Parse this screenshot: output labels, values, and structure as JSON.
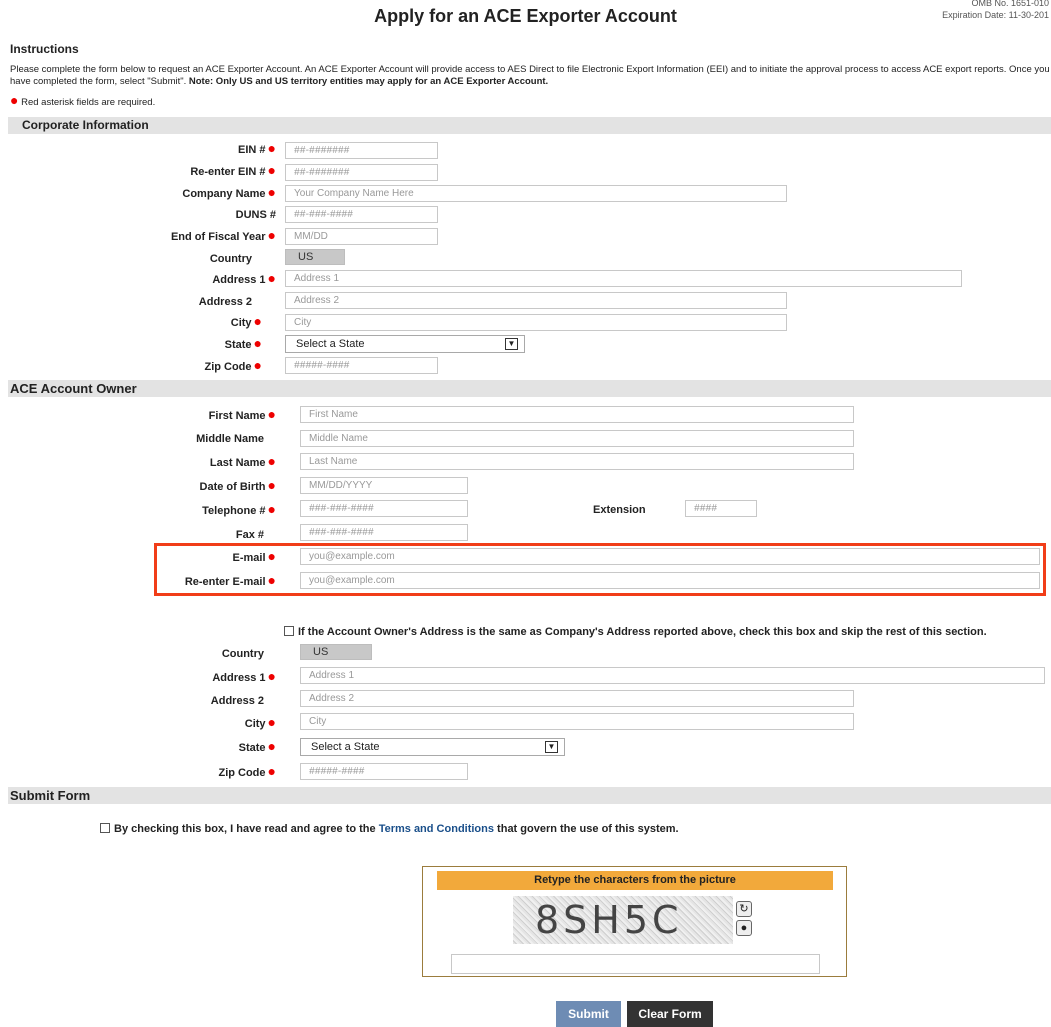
{
  "header": {
    "title": "Apply for an ACE Exporter Account",
    "omb_line": "OMB No. 1651-010",
    "expiration": "Expiration Date: 11-30-201"
  },
  "instructions": {
    "heading": "Instructions",
    "text_1": "Please complete the form below to request an ACE Exporter Account. An ACE Exporter Account will provide access to AES Direct to file Electronic Export Information (EEI) and to initiate the approval process to access ACE export reports. Once you have completed the form, select \"Submit\". ",
    "text_bold": "Note: Only US and US territory entities may apply for an ACE Exporter Account.",
    "required_note": "Red asterisk fields are required."
  },
  "corporate": {
    "section_title": "Corporate Information",
    "ein_label": "EIN #",
    "ein_placeholder": "##-#######",
    "reein_label": "Re-enter EIN #",
    "reein_placeholder": "##-#######",
    "company_label": "Company Name",
    "company_placeholder": "Your Company Name Here",
    "duns_label": "DUNS #",
    "duns_placeholder": "##-###-####",
    "fiscal_label": "End of Fiscal Year",
    "fiscal_placeholder": "MM/DD",
    "country_label": "Country",
    "country_value": "US",
    "address1_label": "Address 1",
    "address1_placeholder": "Address 1",
    "address2_label": "Address 2",
    "address2_placeholder": "Address 2",
    "city_label": "City",
    "city_placeholder": "City",
    "state_label": "State",
    "state_value": "Select a State",
    "zip_label": "Zip Code",
    "zip_placeholder": "#####-####"
  },
  "owner": {
    "section_title": "ACE Account Owner",
    "first_label": "First Name",
    "first_placeholder": "First Name",
    "middle_label": "Middle Name",
    "middle_placeholder": "Middle Name",
    "last_label": "Last Name",
    "last_placeholder": "Last Name",
    "dob_label": "Date of Birth",
    "dob_placeholder": "MM/DD/YYYY",
    "phone_label": "Telephone #",
    "phone_placeholder": "###-###-####",
    "ext_label": "Extension",
    "ext_placeholder": "####",
    "fax_label": "Fax #",
    "fax_placeholder": "###-###-####",
    "email_label": "E-mail",
    "email_placeholder": "you@example.com",
    "reemail_label": "Re-enter E-mail",
    "reemail_placeholder": "you@example.com",
    "same_address_text": "If the Account Owner's Address is the same as Company's Address reported above, check this box and skip the rest of this section.",
    "country_label": "Country",
    "country_value": "US",
    "address1_label": "Address 1",
    "address1_placeholder": "Address 1",
    "address2_label": "Address 2",
    "address2_placeholder": "Address 2",
    "city_label": "City",
    "city_placeholder": "City",
    "state_label": "State",
    "state_value": "Select a State",
    "zip_label": "Zip Code",
    "zip_placeholder": "#####-####"
  },
  "submit_section": {
    "section_title": "Submit Form",
    "agree_prefix": "By checking this box, I have read and agree to the ",
    "agree_link": "Terms and Conditions",
    "agree_suffix": " that govern the use of this system.",
    "captcha_title": "Retype the characters from the picture",
    "captcha_text": "8SH5C",
    "submit_label": "Submit",
    "clear_label": "Clear Form"
  },
  "colors": {
    "required_dot": "#e00000",
    "highlight": "#f13d18",
    "captcha_header": "#f2a93b",
    "submit_button": "#6e8cb4",
    "clear_button": "#333333",
    "link": "#1a4f8a"
  },
  "icons": {
    "required": "red-dot-icon",
    "select": "chevron-down-icon",
    "captcha_refresh": "refresh-icon",
    "captcha_audio": "audio-icon"
  }
}
